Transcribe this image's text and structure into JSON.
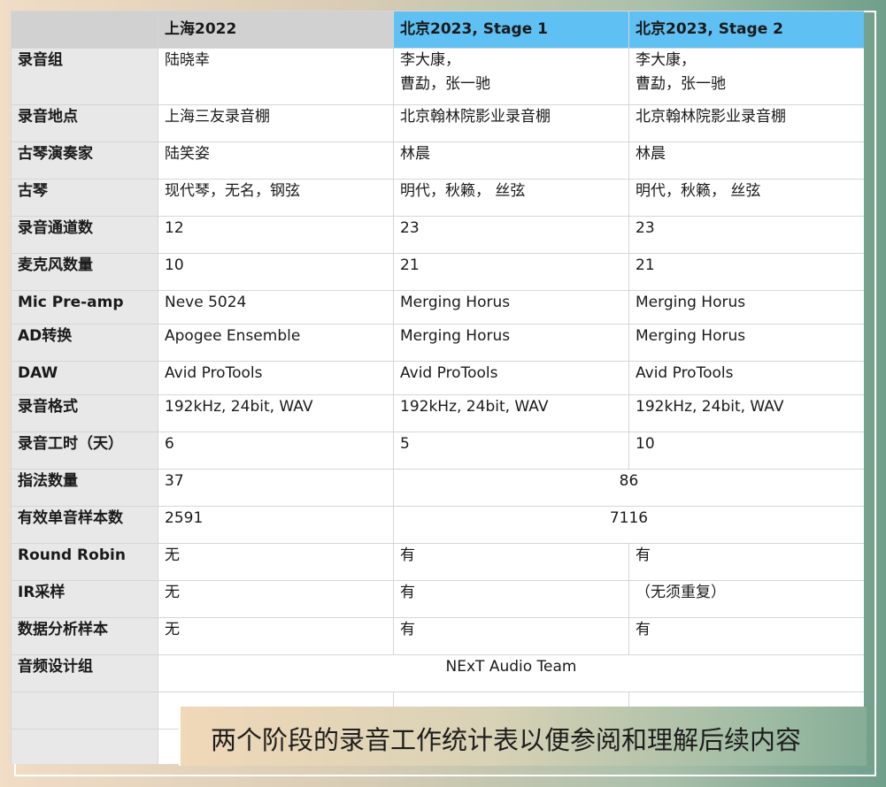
{
  "header": {
    "corner": "",
    "col1": "上海2022",
    "col2": "北京2023, Stage 1",
    "col3": "北京2023, Stage 2"
  },
  "rows": [
    {
      "label": "录音组",
      "v1": "陆晓幸",
      "v2_line1": "李大康，",
      "v2_line2": "曹勐，张一驰",
      "v3_line1": "李大康，",
      "v3_line2": "曹勐，张一驰"
    },
    {
      "label": "录音地点",
      "v1": "上海三友录音棚",
      "v2": "北京翰林院影业录音棚",
      "v3": "北京翰林院影业录音棚"
    },
    {
      "label": "古琴演奏家",
      "v1": "陆笑姿",
      "v2": "林晨",
      "v3": "林晨"
    },
    {
      "label": "古琴",
      "v1": "现代琴，无名，钢弦",
      "v2": "明代，秋籁， 丝弦",
      "v3": "明代，秋籁， 丝弦"
    },
    {
      "label": "录音通道数",
      "v1": "12",
      "v2": "23",
      "v3": "23"
    },
    {
      "label": "麦克风数量",
      "v1": "10",
      "v2": "21",
      "v3": "21"
    },
    {
      "label": "Mic Pre-amp",
      "v1": "Neve 5024",
      "v2": "Merging Horus",
      "v3": "Merging Horus"
    },
    {
      "label": "AD转换",
      "v1": "Apogee Ensemble",
      "v2": "Merging Horus",
      "v3": "Merging Horus"
    },
    {
      "label": "DAW",
      "v1": "Avid ProTools",
      "v2": "Avid ProTools",
      "v3": "Avid ProTools"
    },
    {
      "label": "录音格式",
      "v1": "192kHz, 24bit, WAV",
      "v2": "192kHz, 24bit, WAV",
      "v3": "192kHz, 24bit, WAV"
    },
    {
      "label": "录音工时（天）",
      "v1": "6",
      "v2": "5",
      "v3": "10"
    },
    {
      "label": "指法数量",
      "v1": "37",
      "v23": "86"
    },
    {
      "label": "有效单音样本数",
      "v1": "2591",
      "v23": "7116"
    },
    {
      "label": "Round Robin",
      "v1": "无",
      "v2": "有",
      "v3": "有"
    },
    {
      "label": "IR采样",
      "v1": "无",
      "v2": "有",
      "v3": "（无须重复）"
    },
    {
      "label": "数据分析样本",
      "v1": "无",
      "v2": "有",
      "v3": "有"
    },
    {
      "label": "音频设计组",
      "v123": "NExT Audio Team"
    }
  ],
  "caption": "两个阶段的录音工作统计表以便参阅和理解后续内容",
  "colors": {
    "header_gray": "#d1d1d1",
    "header_blue": "#5ec0f3",
    "label_bg": "#e8e8e8",
    "frame_left": "#f1dcc6",
    "frame_right": "#6f9f8a"
  }
}
